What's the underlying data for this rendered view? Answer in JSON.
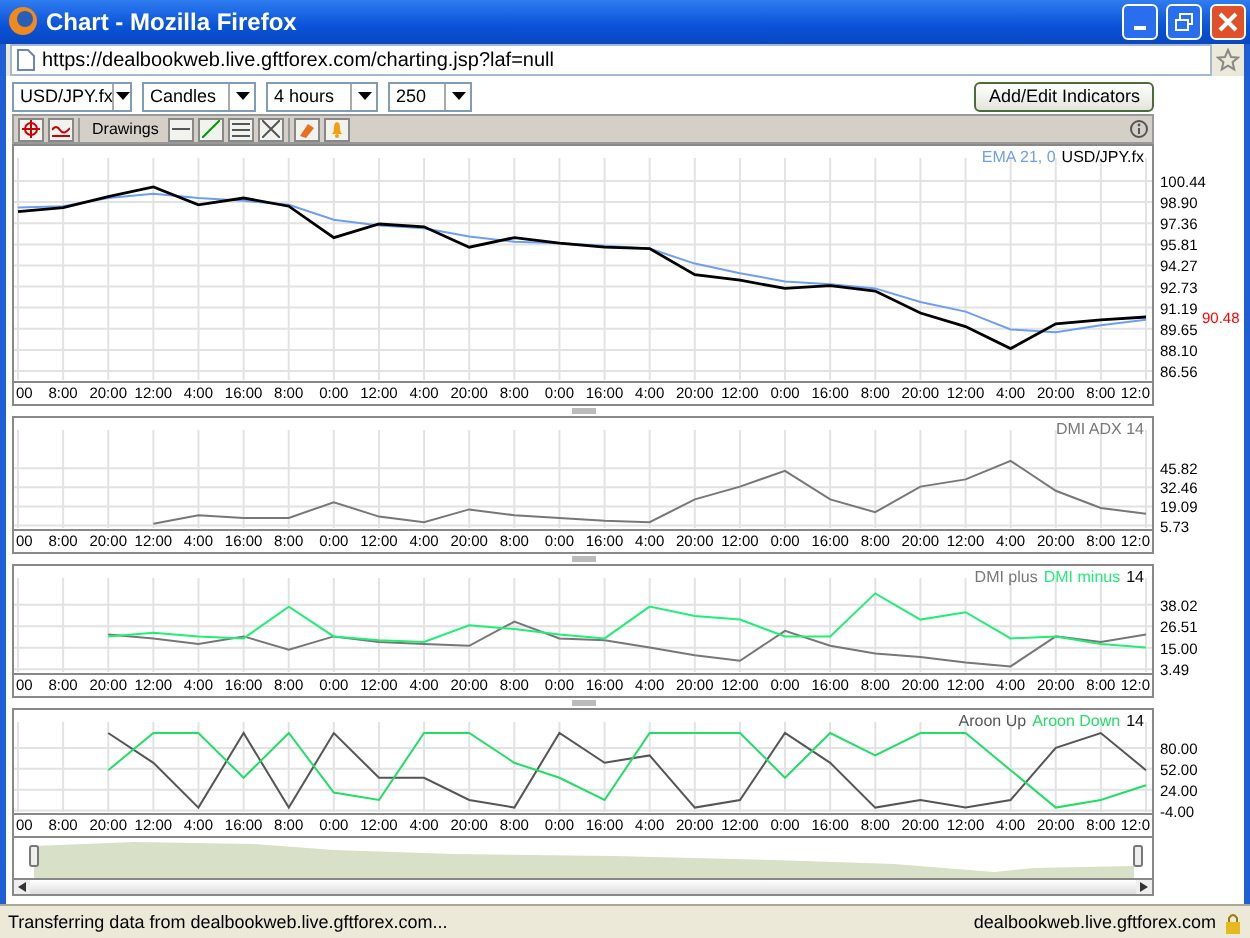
{
  "window": {
    "title": "Chart - Mozilla Firefox"
  },
  "address_bar": {
    "url": "https://dealbookweb.live.gftforex.com/charting.jsp?laf=null"
  },
  "controls": {
    "dropdowns": [
      "USD/JPY.fx",
      "Candles",
      "4 hours",
      "250"
    ],
    "button": "Add/Edit Indicators"
  },
  "chart_toolbar": {
    "label": "Drawings"
  },
  "panes": [
    {
      "kind": "candlestick",
      "last_price": "90.48",
      "chart_data": {
        "type": "line",
        "x": [
          "00",
          "8:00",
          "20:00",
          "12:00",
          "4:00",
          "16:00",
          "8:00",
          "0:00",
          "12:00",
          "4:00",
          "20:00",
          "8:00",
          "0:00",
          "16:00",
          "4:00",
          "20:00",
          "12:00",
          "0:00",
          "16:00",
          "8:00",
          "20:00",
          "12:00",
          "4:00",
          "20:00",
          "8:00",
          "12:0"
        ],
        "ylim": [
          85.9,
          103
        ],
        "grid": true,
        "yticks": [
          {
            "value": 100.44,
            "label": "100.44"
          },
          {
            "value": 98.9,
            "label": "98.90"
          },
          {
            "value": 97.36,
            "label": "97.36"
          },
          {
            "value": 95.81,
            "label": "95.81"
          },
          {
            "value": 94.27,
            "label": "94.27"
          },
          {
            "value": 92.73,
            "label": "92.73"
          },
          {
            "value": 91.19,
            "label": "91.19"
          },
          {
            "value": 89.65,
            "label": "89.65"
          },
          {
            "value": 88.1,
            "label": "88.10"
          },
          {
            "value": 86.56,
            "label": "86.56"
          }
        ],
        "series": [
          {
            "name": "EMA 21, 0",
            "color": "#6f9ef0",
            "values": [
              98.5,
              98.6,
              99.2,
              99.5,
              99.2,
              99.0,
              98.7,
              97.6,
              97.2,
              97.0,
              96.4,
              96.0,
              95.9,
              95.7,
              95.5,
              94.4,
              93.7,
              93.1,
              92.9,
              92.6,
              91.6,
              90.9,
              89.6,
              89.4,
              89.9,
              90.3
            ]
          },
          {
            "name": "USD/JPY.fx",
            "color": "#000000",
            "values": [
              98.2,
              98.5,
              99.3,
              100.0,
              98.7,
              99.2,
              98.6,
              96.3,
              97.3,
              97.1,
              95.6,
              96.3,
              95.9,
              95.6,
              95.5,
              93.6,
              93.2,
              92.6,
              92.8,
              92.4,
              90.8,
              89.8,
              88.2,
              90.0,
              90.3,
              90.5
            ]
          }
        ]
      }
    },
    {
      "kind": "indicator",
      "chart_data": {
        "type": "line",
        "x": [
          "00",
          "8:00",
          "20:00",
          "12:00",
          "4:00",
          "16:00",
          "8:00",
          "0:00",
          "12:00",
          "4:00",
          "20:00",
          "8:00",
          "0:00",
          "16:00",
          "4:00",
          "20:00",
          "12:00",
          "0:00",
          "16:00",
          "8:00",
          "20:00",
          "12:00",
          "4:00",
          "20:00",
          "8:00",
          "12:0"
        ],
        "ylim": [
          4,
          81
        ],
        "grid": true,
        "yticks": [
          {
            "value": 45.82,
            "label": "45.82"
          },
          {
            "value": 32.46,
            "label": "32.46"
          },
          {
            "value": 19.09,
            "label": "19.09"
          },
          {
            "value": 5.73,
            "label": "5.73"
          }
        ],
        "series": [
          {
            "name": "DMI ADX 14",
            "color": "#777777",
            "values": [
              null,
              null,
              null,
              7,
              13,
              11,
              11,
              22,
              12,
              8,
              17,
              13,
              11,
              9,
              8,
              24,
              33,
              44,
              24,
              15,
              33,
              38,
              51,
              30,
              18,
              14
            ]
          }
        ]
      }
    },
    {
      "kind": "indicator",
      "legend_suffix": "14",
      "chart_data": {
        "type": "line",
        "x": [
          "00",
          "8:00",
          "20:00",
          "12:00",
          "4:00",
          "16:00",
          "8:00",
          "0:00",
          "12:00",
          "4:00",
          "20:00",
          "8:00",
          "0:00",
          "16:00",
          "4:00",
          "20:00",
          "12:00",
          "0:00",
          "16:00",
          "8:00",
          "20:00",
          "12:00",
          "4:00",
          "20:00",
          "8:00",
          "12:0"
        ],
        "ylim": [
          2,
          58.7
        ],
        "grid": true,
        "yticks": [
          {
            "value": 38.02,
            "label": "38.02"
          },
          {
            "value": 26.51,
            "label": "26.51"
          },
          {
            "value": 15,
            "label": "15.00"
          },
          {
            "value": 3.49,
            "label": "3.49"
          }
        ],
        "series": [
          {
            "name": "DMI plus",
            "color": "#777777",
            "values": [
              null,
              null,
              22,
              20,
              17,
              21,
              14,
              21,
              18,
              17,
              16,
              29,
              20,
              19,
              15,
              11,
              8,
              24,
              16,
              12,
              10,
              7,
              5,
              21,
              18,
              22
            ]
          },
          {
            "name": "DMI minus",
            "color": "#22ee77",
            "values": [
              null,
              null,
              21,
              23,
              21,
              20,
              37,
              21,
              19,
              18,
              27,
              25,
              22,
              20,
              37,
              32,
              30,
              21,
              21,
              44,
              30,
              34,
              20,
              21,
              17,
              15
            ]
          }
        ]
      }
    },
    {
      "kind": "indicator",
      "legend_suffix": "14",
      "chart_data": {
        "type": "line",
        "x": [
          "00",
          "8:00",
          "20:00",
          "12:00",
          "4:00",
          "16:00",
          "8:00",
          "0:00",
          "12:00",
          "4:00",
          "20:00",
          "8:00",
          "0:00",
          "16:00",
          "4:00",
          "20:00",
          "12:00",
          "0:00",
          "16:00",
          "8:00",
          "20:00",
          "12:00",
          "4:00",
          "20:00",
          "8:00",
          "12:0"
        ],
        "ylim": [
          -6,
          130.8
        ],
        "grid": true,
        "yticks": [
          {
            "value": 80,
            "label": "80.00"
          },
          {
            "value": 52,
            "label": "52.00"
          },
          {
            "value": 24,
            "label": "24.00"
          },
          {
            "value": -4,
            "label": "-4.00"
          }
        ],
        "series": [
          {
            "name": "Aroon Up",
            "color": "#555555",
            "values": [
              null,
              null,
              100,
              60,
              0,
              100,
              0,
              100,
              40,
              40,
              10,
              0,
              100,
              60,
              70,
              0,
              10,
              100,
              60,
              0,
              10,
              0,
              10,
              80,
              100,
              50
            ]
          },
          {
            "name": "Aroon Down",
            "color": "#22dd66",
            "values": [
              null,
              null,
              50,
              100,
              100,
              40,
              100,
              20,
              10,
              100,
              100,
              60,
              40,
              10,
              100,
              100,
              100,
              40,
              100,
              70,
              100,
              100,
              50,
              0,
              10,
              30
            ]
          }
        ]
      }
    }
  ],
  "status_bar": {
    "message": "Transferring data from dealbookweb.live.gftforex.com...",
    "host": "dealbookweb.live.gftforex.com"
  }
}
